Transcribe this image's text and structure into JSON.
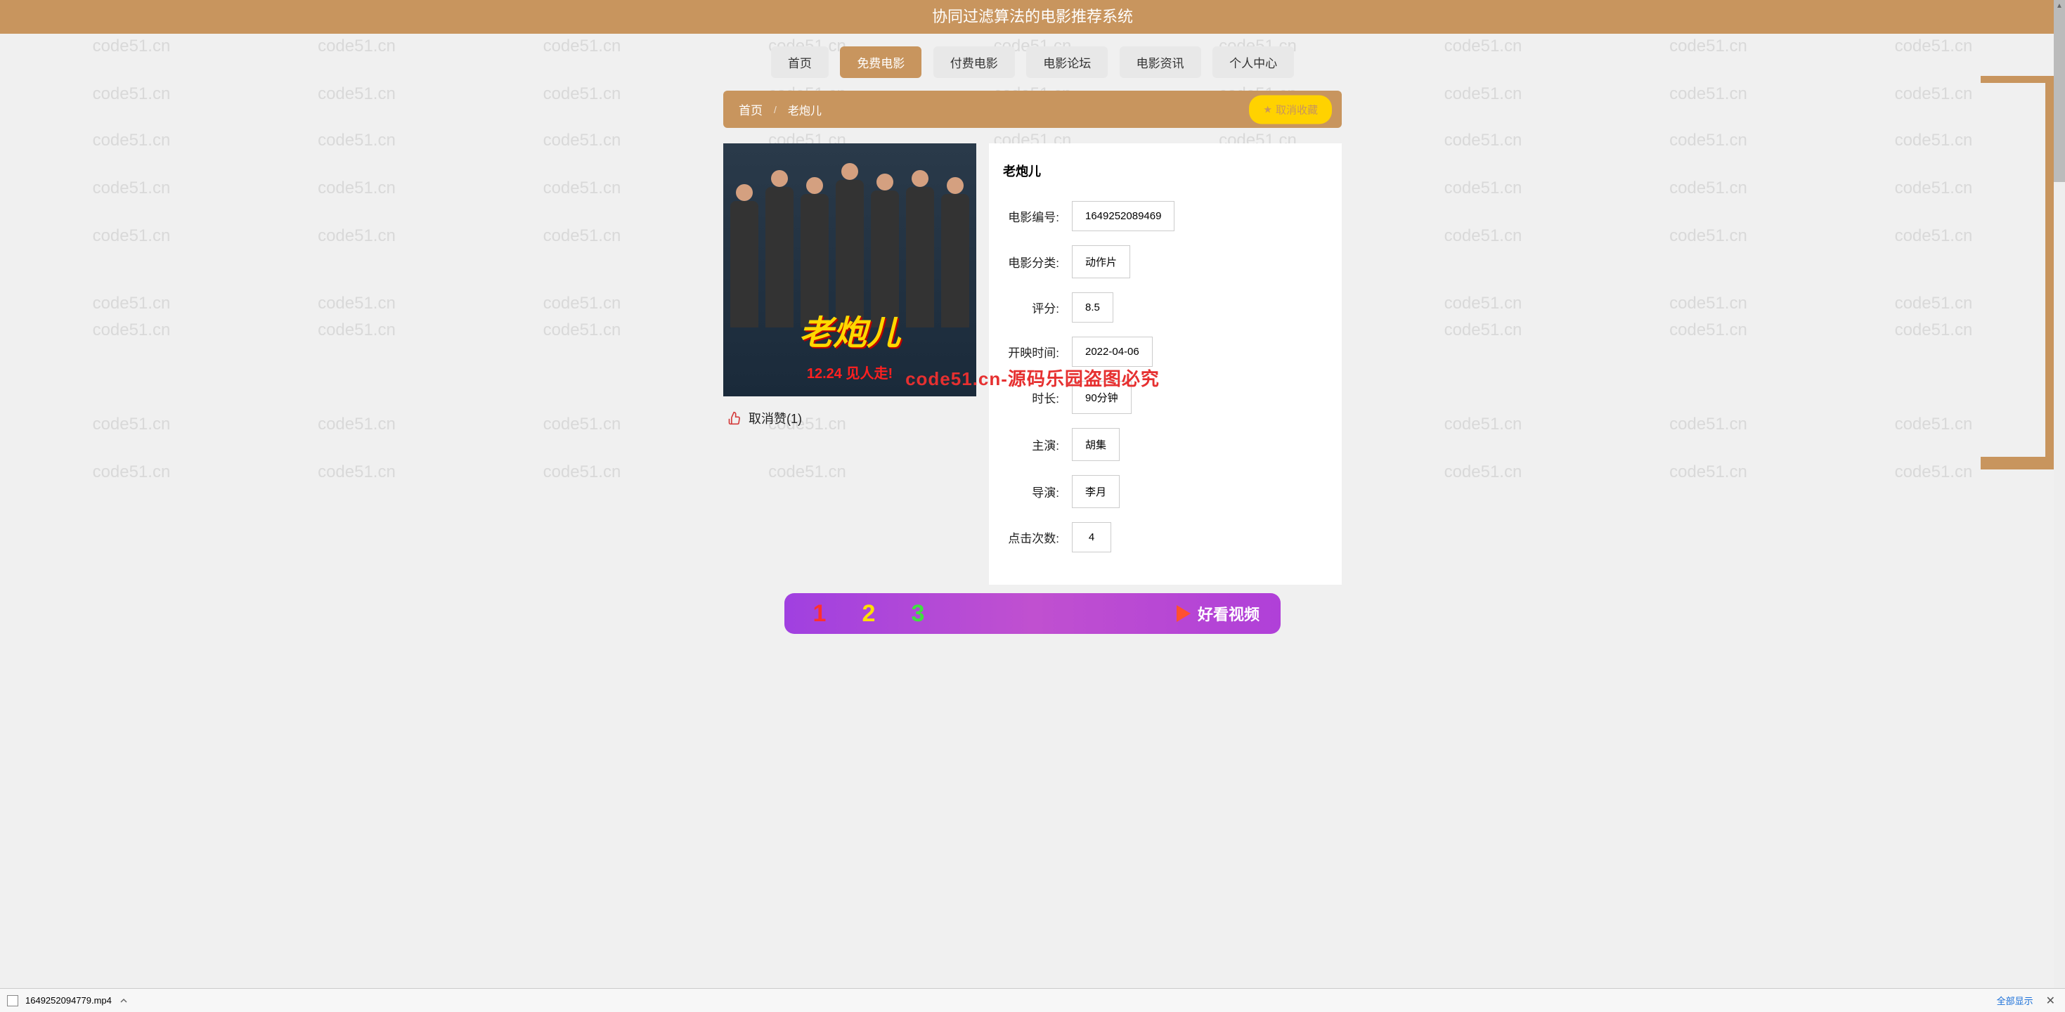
{
  "header": {
    "title": "协同过滤算法的电影推荐系统"
  },
  "nav": {
    "items": [
      {
        "label": "首页",
        "active": false
      },
      {
        "label": "免费电影",
        "active": true
      },
      {
        "label": "付费电影",
        "active": false
      },
      {
        "label": "电影论坛",
        "active": false
      },
      {
        "label": "电影资讯",
        "active": false
      },
      {
        "label": "个人中心",
        "active": false
      }
    ]
  },
  "breadcrumb": {
    "home": "首页",
    "current": "老炮儿",
    "fav_button": "取消收藏"
  },
  "movie": {
    "title": "老炮儿",
    "poster_title": "老炮儿",
    "poster_date": "12.24 见人走!",
    "fields": {
      "id_label": "电影编号:",
      "id_value": "1649252089469",
      "category_label": "电影分类:",
      "category_value": "动作片",
      "rating_label": "评分:",
      "rating_value": "8.5",
      "release_label": "开映时间:",
      "release_value": "2022-04-06",
      "duration_label": "时长:",
      "duration_value": "90分钟",
      "cast_label": "主演:",
      "cast_value": "胡集",
      "director_label": "导演:",
      "director_value": "李月",
      "clicks_label": "点击次数:",
      "clicks_value": "4"
    },
    "like": {
      "label": "取消赞",
      "count": "1"
    }
  },
  "promo": {
    "n1": "1",
    "n2": "2",
    "n3": "3",
    "brand_text": "好看视频"
  },
  "watermark": {
    "text": "code51.cn",
    "center_text": "code51.cn-源码乐园盗图必究"
  },
  "download_bar": {
    "filename": "1649252094779.mp4",
    "show_all": "全部显示"
  }
}
